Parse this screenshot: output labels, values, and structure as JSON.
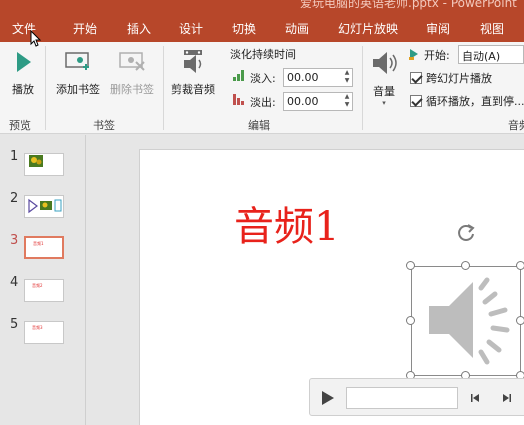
{
  "window": {
    "title": "爱玩电脑的英语老师.pptx - PowerPoint"
  },
  "tabs": [
    "文件",
    "开始",
    "插入",
    "设计",
    "切换",
    "动画",
    "幻灯片放映",
    "审阅",
    "视图"
  ],
  "ribbon": {
    "preview": {
      "play_label": "播放",
      "group_label": "预览"
    },
    "bookmarks": {
      "add_label": "添加书签",
      "remove_label": "删除书签",
      "group_label": "书签"
    },
    "editing": {
      "trim_label": "剪裁音频",
      "fade_title": "淡化持续时间",
      "fade_in_label": "淡入:",
      "fade_in_value": "00.00",
      "fade_out_label": "淡出:",
      "fade_out_value": "00.00",
      "group_label": "编辑"
    },
    "audio_options": {
      "volume_label": "音量",
      "start_label": "开始:",
      "start_value": "自动(A)",
      "cross_slides_label": "跨幻灯片播放",
      "loop_label": "循环播放，直到停...",
      "group_label": "音频"
    }
  },
  "slides": [
    {
      "num": "1"
    },
    {
      "num": "2"
    },
    {
      "num": "3",
      "mini": "音频1"
    },
    {
      "num": "4",
      "mini": "音频2"
    },
    {
      "num": "5",
      "mini": "音频3"
    }
  ],
  "current_slide": {
    "title": "音频1"
  },
  "colors": {
    "accent": "#b7472a",
    "title_red": "#e8221b",
    "active_thumb": "#e07a5f"
  }
}
